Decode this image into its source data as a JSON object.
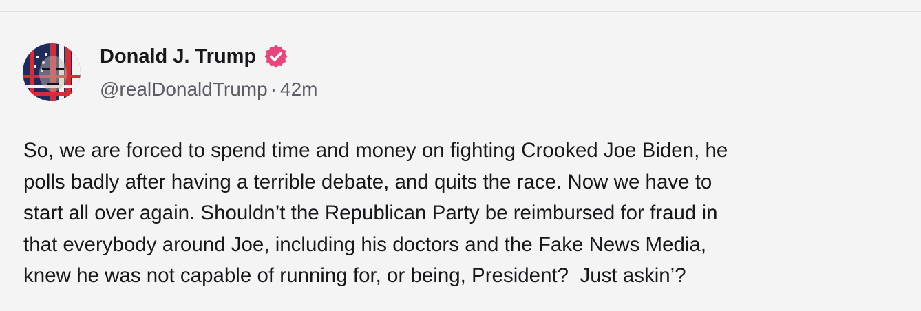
{
  "author": {
    "display_name": "Donald J. Trump",
    "handle": "@realDonaldTrump",
    "separator": "·",
    "time_ago": "42m",
    "verified_icon": "verified-badge-icon",
    "avatar": "profile-avatar"
  },
  "post": {
    "lines": [
      "So, we are forced to spend time and money on fighting Crooked Joe Biden, he",
      "polls badly after having a terrible debate, and quits the race. Now we have to",
      "start all over again. Shouldn’t the Republican Party be reimbursed for fraud in",
      "that everybody around Joe, including his doctors and the Fake News Media,",
      "knew he was not capable of running for, or being, President?  Just askin’?"
    ]
  },
  "colors": {
    "background": "#f4f4f5",
    "verified_badge": "#e8467a",
    "text_primary": "#18181b",
    "text_secondary": "#5c5c66"
  }
}
